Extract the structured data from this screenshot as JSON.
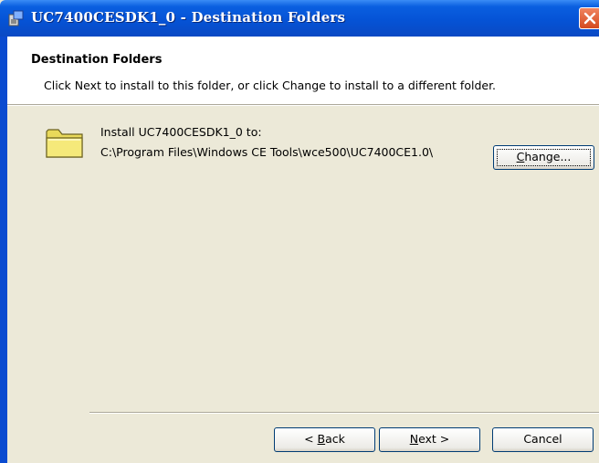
{
  "window": {
    "title": "UC7400CESDK1_0 - Destination Folders"
  },
  "header": {
    "title": "Destination Folders",
    "description": "Click Next to install to this folder, or click Change to install to a different folder."
  },
  "install": {
    "label": "Install UC7400CESDK1_0 to:",
    "path": "C:\\Program Files\\Windows CE Tools\\wce500\\UC7400CE1.0\\"
  },
  "buttons": {
    "change": {
      "mnemonic": "C",
      "rest": "hange..."
    },
    "back": {
      "pre": "< ",
      "mnemonic": "B",
      "rest": "ack"
    },
    "next": {
      "mnemonic": "N",
      "rest": "ext >"
    },
    "cancel": "Cancel"
  },
  "colors": {
    "titlebar": "#0553d6",
    "dialog_bg": "#ece9d8",
    "close_button": "#d44a1f",
    "folder_fill": "#f5e97a"
  },
  "icons": {
    "title": "installer-icon",
    "close": "close-icon",
    "folder": "folder-icon"
  }
}
